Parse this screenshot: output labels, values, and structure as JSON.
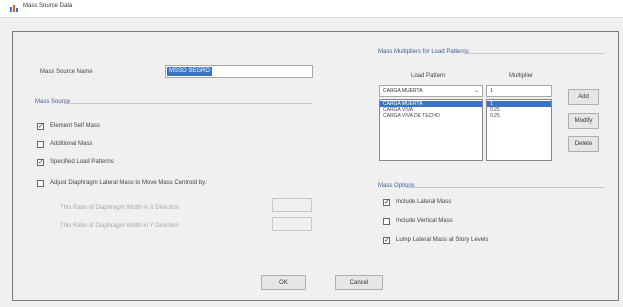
{
  "window": {
    "title": "Mass Source Data"
  },
  "mass_source_name": {
    "label": "Mass Source Name",
    "value": "MSSO SEGRO"
  },
  "mass_source": {
    "heading": "Mass Source",
    "options": [
      {
        "label": "Element Self Mass",
        "checked": true
      },
      {
        "label": "Additional Mass",
        "checked": false
      },
      {
        "label": "Specified Load Patterns",
        "checked": true
      },
      {
        "label": "Adjust Diaphragm Lateral Mass to Move Mass Centroid by:",
        "checked": false
      }
    ],
    "ratio_x_label": "This Ratio of Diaphragm Width in X Direction",
    "ratio_y_label": "This Ratio of Diaphragm Width in Y Direction"
  },
  "load_pattern_multipliers": {
    "heading": "Mass Multipliers for Load Patterns",
    "col_pattern": "Load Pattern",
    "col_multiplier": "Multiplier",
    "combo_value": "CARGA MUERTA",
    "multiplier_value": "1",
    "rows": [
      {
        "pattern": "CARGA MUERTA",
        "multiplier": "1"
      },
      {
        "pattern": "CARGA VIVA",
        "multiplier": "0.25"
      },
      {
        "pattern": "CARGA VIVA DE TECHO",
        "multiplier": "0.25"
      }
    ],
    "add_label": "Add",
    "modify_label": "Modify",
    "delete_label": "Delete"
  },
  "mass_options": {
    "heading": "Mass Options",
    "options": [
      {
        "label": "Include Lateral Mass",
        "checked": true
      },
      {
        "label": "Include Vertical Mass",
        "checked": false
      },
      {
        "label": "Lump Lateral Mass at Story Levels",
        "checked": true
      }
    ]
  },
  "footer": {
    "ok_label": "OK",
    "cancel_label": "Cancel"
  },
  "colors": {
    "selection": "#3a74c4",
    "frame": "#7a7a7a"
  }
}
